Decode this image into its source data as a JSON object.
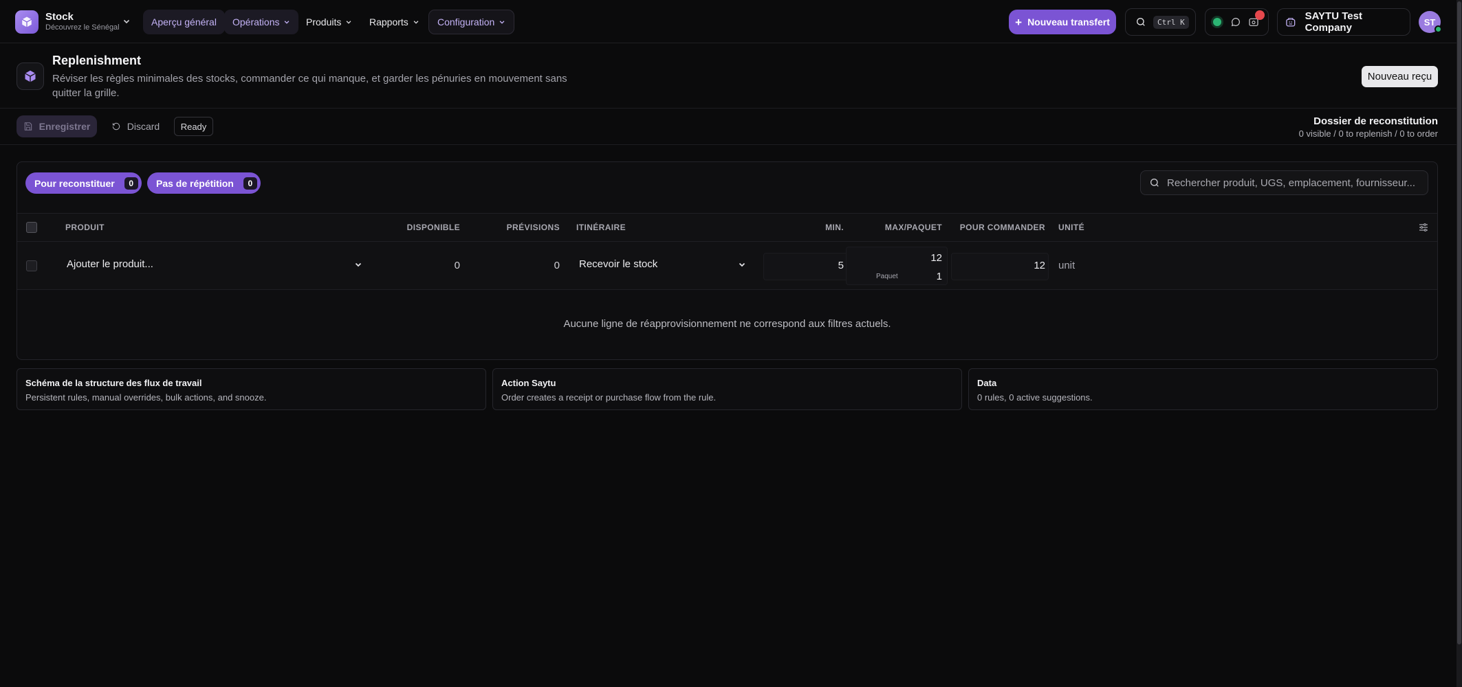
{
  "app": {
    "name": "Stock",
    "subtitle": "Découvrez le Sénégal"
  },
  "nav": {
    "items": [
      {
        "label": "Aperçu général",
        "active": true
      },
      {
        "label": "Opérations"
      },
      {
        "label": "Produits"
      },
      {
        "label": "Rapports"
      },
      {
        "label": "Configuration"
      }
    ],
    "primary_button": "Nouveau transfert",
    "search_shortcut": "Ctrl K",
    "notification_count": "",
    "company": "SAYTU Test Company",
    "avatar_initials": "ST"
  },
  "header": {
    "title": "Replenishment",
    "description": "Réviser les règles minimales des stocks, commander ce qui manque, et garder les pénuries en mouvement sans quitter la grille.",
    "new_receipt_button": "Nouveau reçu"
  },
  "toolbar": {
    "save_label": "Enregistrer",
    "discard_label": "Discard",
    "status": "Ready",
    "folder_title": "Dossier de reconstitution",
    "folder_summary": "0 visible / 0 to replenish / 0 to order"
  },
  "filters": {
    "pills": [
      {
        "label": "Pour reconstituer",
        "count": "0"
      },
      {
        "label": "Pas de répétition",
        "count": "0"
      }
    ],
    "search_placeholder": "Rechercher produit, UGS, emplacement, fournisseur..."
  },
  "table": {
    "columns": {
      "product": "PRODUIT",
      "available": "DISPONIBLE",
      "forecast": "PRÉVISIONS",
      "route": "ITINÉRAIRE",
      "min": "MIN.",
      "max_pack": "MAX/PAQUET",
      "to_order": "POUR COMMANDER",
      "unit": "UNITÉ"
    },
    "new_row": {
      "product": "Ajouter le produit...",
      "available": "0",
      "forecast": "0",
      "route": "Recevoir le stock",
      "min": "5",
      "max": "12",
      "pack_label": "Paquet",
      "pack": "1",
      "to_order": "12",
      "unit": "unit"
    },
    "empty_message": "Aucune ligne de réapprovisionnement ne correspond aux filtres actuels."
  },
  "cards": [
    {
      "title": "Schéma de la structure des flux de travail",
      "text": "Persistent rules, manual overrides, bulk actions, and snooze."
    },
    {
      "title": "Action Saytu",
      "text": "Order creates a receipt or purchase flow from the rule."
    },
    {
      "title": "Data",
      "text": "0 rules, 0 active suggestions."
    }
  ],
  "colors": {
    "accent": "#7b54d4",
    "background": "#0b0b0c",
    "status_online": "#2bb673",
    "notification": "#e5484d"
  }
}
